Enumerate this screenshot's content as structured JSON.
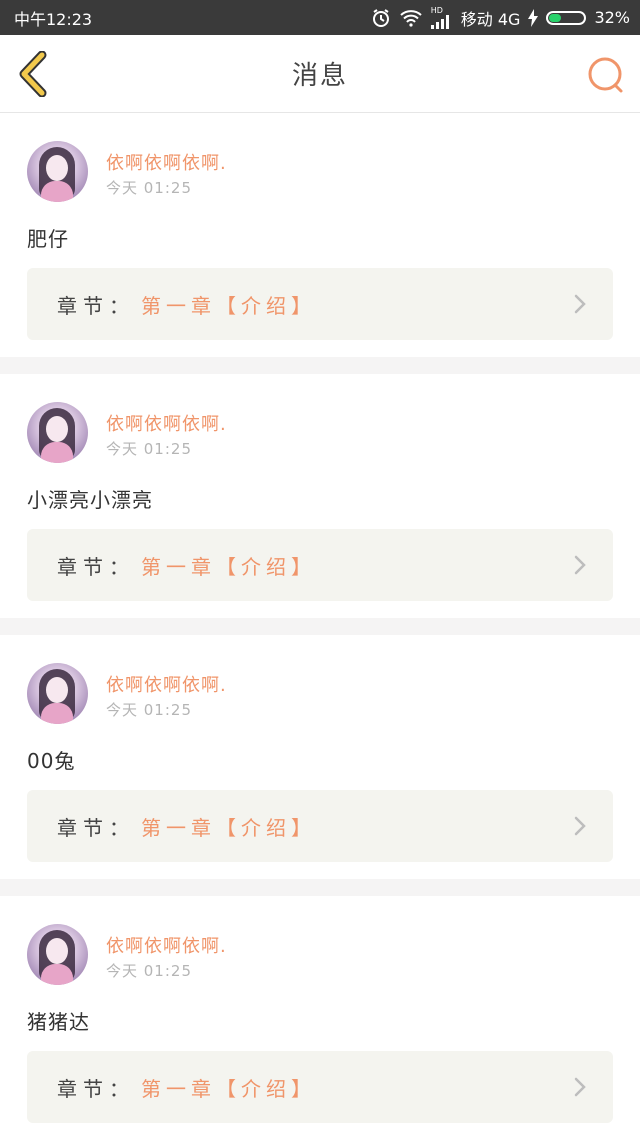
{
  "status_bar": {
    "time": "中午12:23",
    "network_badge": "HD",
    "carrier": "移动 4G",
    "battery_percent": "32%",
    "battery_level": 0.32,
    "icons": [
      "alarm-icon",
      "wifi-icon",
      "signal-icon",
      "charging-icon",
      "battery-icon"
    ]
  },
  "header": {
    "title": "消息",
    "back_icon": "chevron-left-icon",
    "search_icon": "search-icon"
  },
  "colors": {
    "accent": "#f0956a",
    "back_icon": "#f2c94c"
  },
  "messages": [
    {
      "user": "依啊依啊依啊.",
      "time": "今天 01:25",
      "text": "肥仔",
      "chapter_label": "章节：",
      "chapter_value": "第一章【介绍】"
    },
    {
      "user": "依啊依啊依啊.",
      "time": "今天 01:25",
      "text": "小漂亮小漂亮",
      "chapter_label": "章节：",
      "chapter_value": "第一章【介绍】"
    },
    {
      "user": "依啊依啊依啊.",
      "time": "今天 01:25",
      "text": "00兔",
      "chapter_label": "章节：",
      "chapter_value": "第一章【介绍】"
    },
    {
      "user": "依啊依啊依啊.",
      "time": "今天 01:25",
      "text": "猪猪达",
      "chapter_label": "章节：",
      "chapter_value": "第一章【介绍】"
    }
  ]
}
